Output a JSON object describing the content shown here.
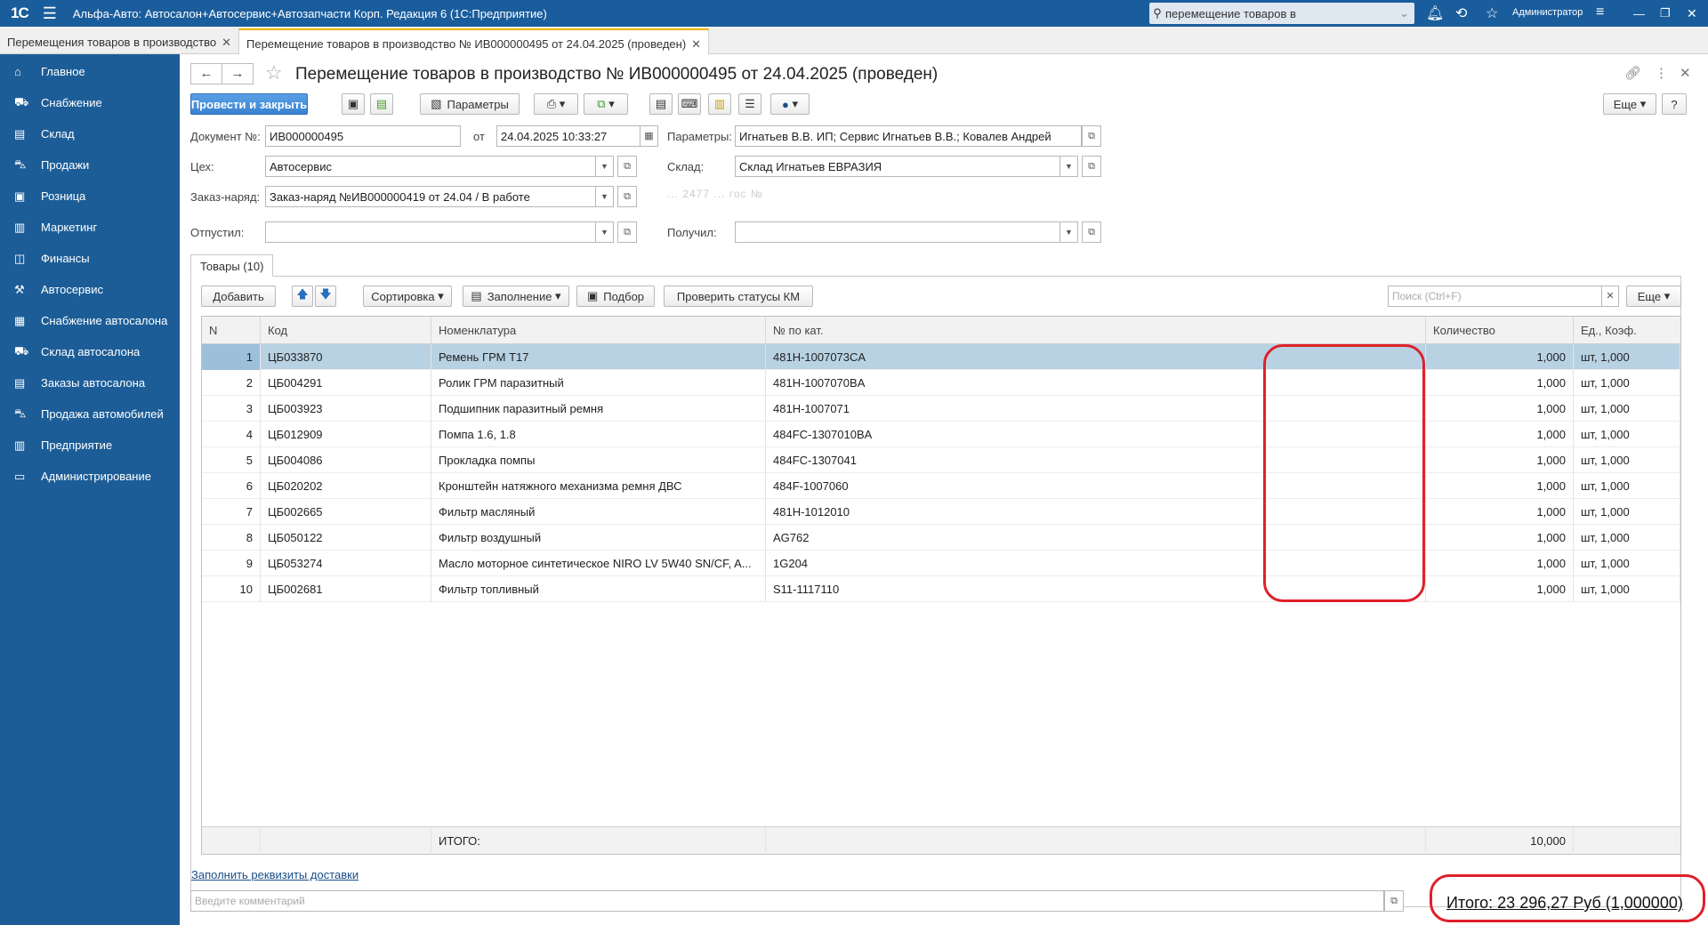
{
  "titlebar": {
    "logo": "1С",
    "app_title": "Альфа-Авто: Автосалон+Автосервис+Автозапчасти Корп. Редакция 6  (1С:Предприятие)",
    "search_value": "перемещение товаров в",
    "user": "Администратор"
  },
  "open_tabs": [
    {
      "label": "Перемещения товаров в производство"
    },
    {
      "label": "Перемещение товаров в производство № ИВ000000495 от 24.04.2025 (проведен)"
    }
  ],
  "sidebar": {
    "items": [
      {
        "label": "Главное",
        "icon": "home-icon"
      },
      {
        "label": "Снабжение",
        "icon": "truck-icon"
      },
      {
        "label": "Склад",
        "icon": "warehouse-icon"
      },
      {
        "label": "Продажи",
        "icon": "cart-icon"
      },
      {
        "label": "Розница",
        "icon": "cash-register-icon"
      },
      {
        "label": "Маркетинг",
        "icon": "chart-icon"
      },
      {
        "label": "Финансы",
        "icon": "wallet-icon"
      },
      {
        "label": "Автосервис",
        "icon": "tools-icon"
      },
      {
        "label": "Снабжение автосалона",
        "icon": "clipboard-icon"
      },
      {
        "label": "Склад автосалона",
        "icon": "car-truck-icon"
      },
      {
        "label": "Заказы автосалона",
        "icon": "document-icon"
      },
      {
        "label": "Продажа автомобилей",
        "icon": "car-icon"
      },
      {
        "label": "Предприятие",
        "icon": "building-icon"
      },
      {
        "label": "Администрирование",
        "icon": "monitor-icon"
      }
    ]
  },
  "document": {
    "title": "Перемещение товаров в производство № ИВ000000495 от 24.04.2025 (проведен)",
    "toolbar": {
      "post_close": "Провести и закрыть",
      "params": "Параметры",
      "more": "Еще",
      "help": "?"
    },
    "fields": {
      "doc_no_label": "Документ №:",
      "doc_no": "ИВ000000495",
      "from_label": "от",
      "date": "24.04.2025 10:33:27",
      "params_label": "Параметры:",
      "params": "Игнатьев В.В. ИП; Сервис Игнатьев В.В.; Ковалев Андрей",
      "shop_label": "Цех:",
      "shop": "Автосервис",
      "warehouse_label": "Склад:",
      "warehouse": "Склад Игнатьев ЕВРАЗИЯ",
      "order_label": "Заказ-наряд:",
      "order": "Заказ-наряд №ИВ000000419 от 24.04 / В работе",
      "order_hint": "... 2477 ... гос №",
      "released_label": "Отпустил:",
      "released": "",
      "received_label": "Получил:",
      "received": ""
    },
    "goods_tab": "Товары (10)",
    "table_toolbar": {
      "add": "Добавить",
      "sort": "Сортировка",
      "fill": "Заполнение",
      "pick": "Подбор",
      "check_km": "Проверить статусы КМ",
      "search_placeholder": "Поиск (Ctrl+F)",
      "more": "Еще"
    },
    "columns": [
      "N",
      "Код",
      "Номенклатура",
      "№ по кат.",
      "Количество",
      "Ед., Коэф."
    ],
    "rows": [
      {
        "n": "1",
        "code": "ЦБ033870",
        "name": "Ремень ГРМ Т17",
        "cat": "481H-1007073CA",
        "qty": "1,000",
        "unit": "шт, 1,000"
      },
      {
        "n": "2",
        "code": "ЦБ004291",
        "name": "Ролик ГРМ паразитный",
        "cat": "481H-1007070BA",
        "qty": "1,000",
        "unit": "шт, 1,000"
      },
      {
        "n": "3",
        "code": "ЦБ003923",
        "name": "Подшипник паразитный ремня",
        "cat": "481H-1007071",
        "qty": "1,000",
        "unit": "шт, 1,000"
      },
      {
        "n": "4",
        "code": "ЦБ012909",
        "name": "Помпа 1.6, 1.8",
        "cat": "484FC-1307010BA",
        "qty": "1,000",
        "unit": "шт, 1,000"
      },
      {
        "n": "5",
        "code": "ЦБ004086",
        "name": "Прокладка помпы",
        "cat": "484FC-1307041",
        "qty": "1,000",
        "unit": "шт, 1,000"
      },
      {
        "n": "6",
        "code": "ЦБ020202",
        "name": "Кронштейн натяжного механизма ремня ДВС",
        "cat": "484F-1007060",
        "qty": "1,000",
        "unit": "шт, 1,000"
      },
      {
        "n": "7",
        "code": "ЦБ002665",
        "name": "Фильтр масляный",
        "cat": "481H-1012010",
        "qty": "1,000",
        "unit": "шт, 1,000"
      },
      {
        "n": "8",
        "code": "ЦБ050122",
        "name": "Фильтр воздушный",
        "cat": "AG762",
        "qty": "1,000",
        "unit": "шт, 1,000"
      },
      {
        "n": "9",
        "code": "ЦБ053274",
        "name": "Масло моторное синтетическое NIRO LV 5W40 SN/CF, A...",
        "cat": "1G204",
        "qty": "1,000",
        "unit": "шт, 1,000"
      },
      {
        "n": "10",
        "code": "ЦБ002681",
        "name": "Фильтр топливный",
        "cat": "S11-1117110",
        "qty": "1,000",
        "unit": "шт, 1,000"
      }
    ],
    "footer": {
      "label": "ИТОГО:",
      "qty_total": "10,000"
    },
    "delivery_link": "Заполнить реквизиты доставки",
    "comment_placeholder": "Введите комментарий",
    "total": "Итого: 23 296,27 Руб (1,000000)"
  },
  "colors": {
    "sidebar": "#1c5d97",
    "titlebar": "#1a5d9c",
    "selected_row": "#b8d2e4",
    "annotation": "#e0202a"
  }
}
